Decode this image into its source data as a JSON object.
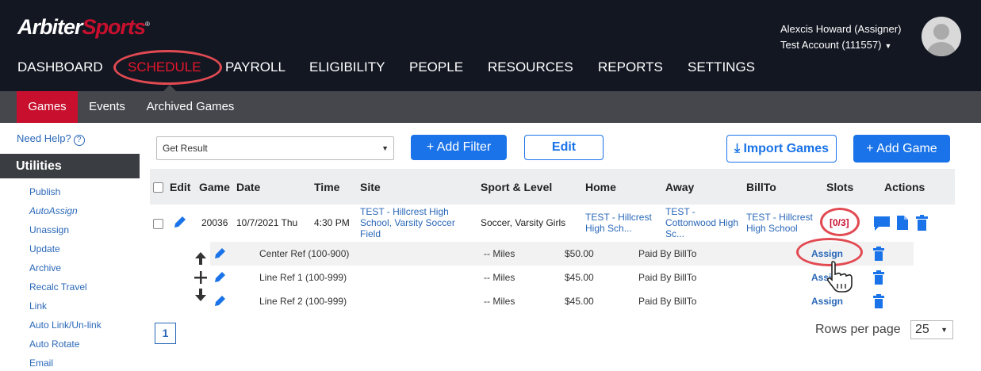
{
  "brand": {
    "name_part1": "Arbiter",
    "name_part2": "Sports",
    "tm": "®"
  },
  "nav": {
    "items": [
      "DASHBOARD",
      "SCHEDULE",
      "PAYROLL",
      "ELIGIBILITY",
      "PEOPLE",
      "RESOURCES",
      "REPORTS",
      "SETTINGS"
    ],
    "active": "SCHEDULE"
  },
  "user": {
    "name": "Alexcis Howard (Assigner)",
    "account": "Test Account (111557)"
  },
  "subnav": {
    "items": [
      "Games",
      "Events",
      "Archived Games"
    ],
    "active": "Games"
  },
  "sidebar": {
    "help": "Need Help?",
    "utilities_title": "Utilities",
    "items": [
      "Publish",
      "AutoAssign",
      "Unassign",
      "Update",
      "Archive",
      "Recalc Travel",
      "Link",
      "Auto Link/Un-link",
      "Auto Rotate",
      "Email"
    ]
  },
  "toolbar": {
    "filter_select": "Get Result",
    "add_filter": "Add Filter",
    "edit": "Edit",
    "import_games": "Import Games",
    "add_game": "Add Game"
  },
  "table": {
    "headers": [
      "Edit",
      "Game",
      "Date",
      "Time",
      "Site",
      "Sport & Level",
      "Home",
      "Away",
      "BillTo",
      "Slots",
      "Actions"
    ],
    "game": {
      "id": "20036",
      "date": "10/7/2021 Thu",
      "time": "4:30 PM",
      "site": "TEST - Hillcrest High School, Varsity Soccer Field",
      "sport_level": "Soccer, Varsity Girls",
      "home": "TEST - Hillcrest High Sch...",
      "away": "TEST - Cottonwood High Sc...",
      "billto": "TEST - Hillcrest High School",
      "slots": "[0/3]"
    },
    "slots": [
      {
        "position": "Center Ref (100-900)",
        "miles": "-- Miles",
        "fee": "$50.00",
        "paid_by": "Paid By BillTo",
        "action": "Assign"
      },
      {
        "position": "Line Ref 1 (100-999)",
        "miles": "-- Miles",
        "fee": "$45.00",
        "paid_by": "Paid By BillTo",
        "action": "Assign"
      },
      {
        "position": "Line Ref 2 (100-999)",
        "miles": "-- Miles",
        "fee": "$45.00",
        "paid_by": "Paid By BillTo",
        "action": "Assign"
      }
    ]
  },
  "pagination": {
    "current": "1",
    "rows_per_page_label": "Rows per page",
    "rows_per_page": "25"
  },
  "colors": {
    "nav_bg": "#131722",
    "accent_red": "#c8102e",
    "link_blue": "#2a68b8",
    "button_blue": "#1a73e8",
    "highlight_ring": "#e24a52"
  }
}
